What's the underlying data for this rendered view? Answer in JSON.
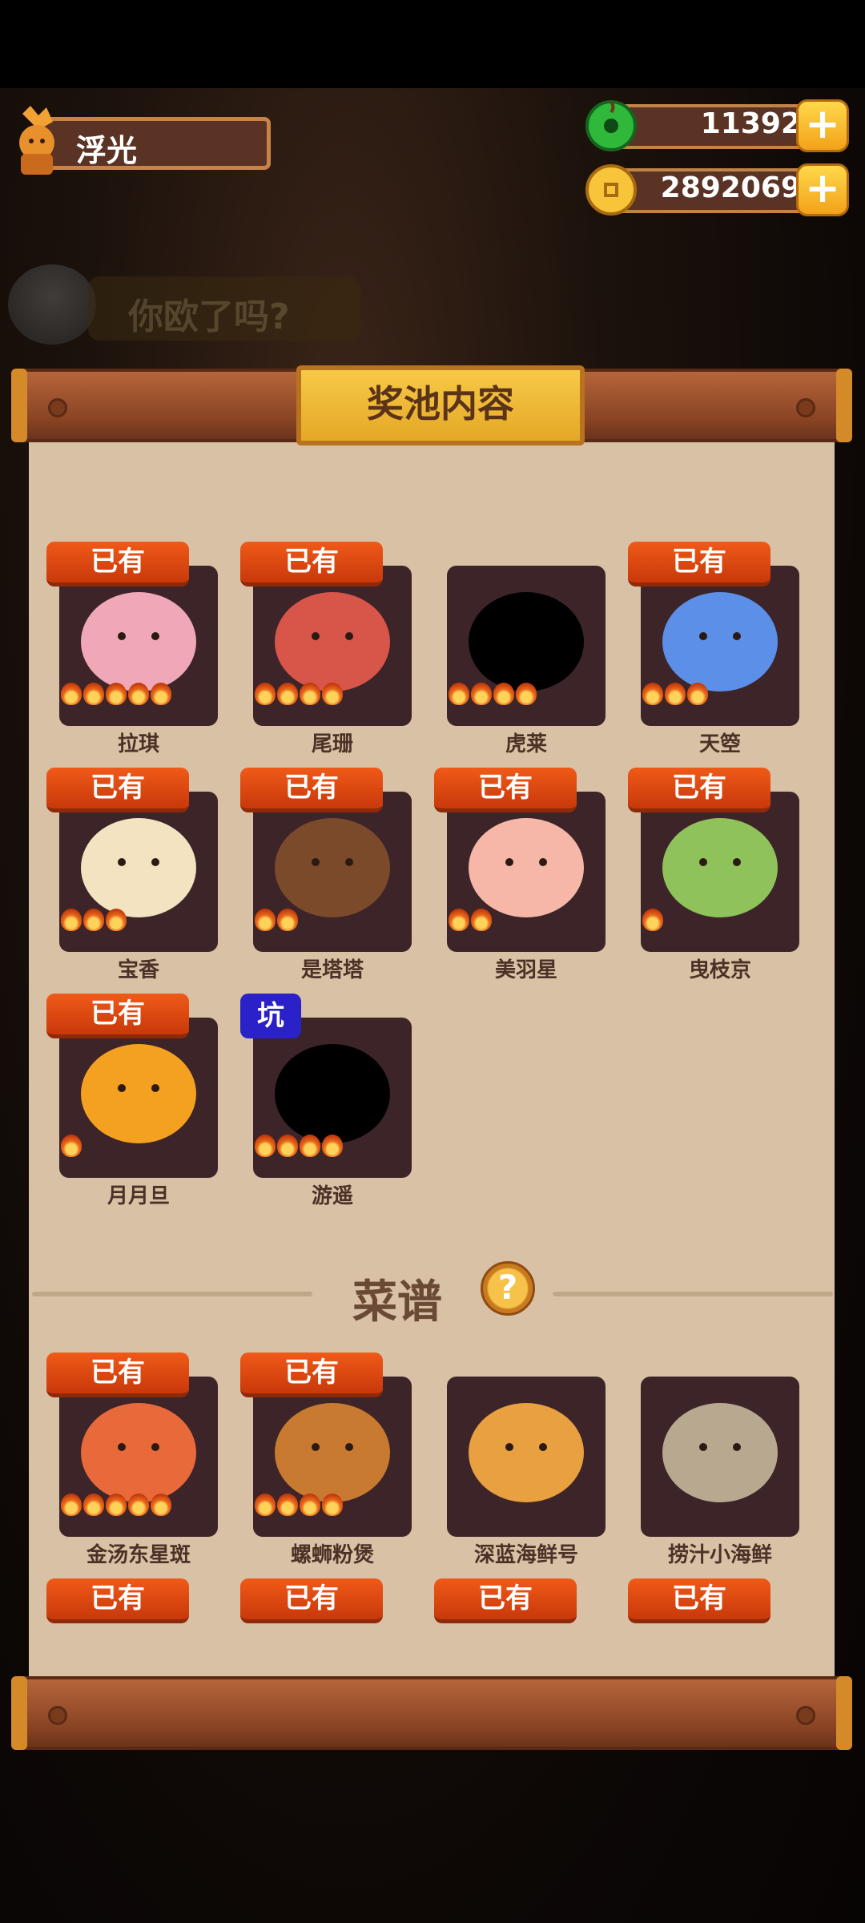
{
  "player": {
    "name": "浮光"
  },
  "currency": {
    "jade": "11392",
    "coins": "2892069"
  },
  "background": {
    "banner_text": "你欧了吗?"
  },
  "panel": {
    "title": "奖池内容"
  },
  "owned_label": "已有",
  "pit_label": "坑",
  "characters": [
    {
      "name": "拉琪",
      "owned": true,
      "stars": 5,
      "color": "#f0a8b8"
    },
    {
      "name": "尾珊",
      "owned": true,
      "stars": 4,
      "color": "#d8554a"
    },
    {
      "name": "虎莱",
      "owned": false,
      "stars": 4,
      "color": "#000000"
    },
    {
      "name": "天箜",
      "owned": true,
      "stars": 3,
      "color": "#5b8fe8"
    },
    {
      "name": "宝香",
      "owned": true,
      "stars": 3,
      "color": "#f3e3c0"
    },
    {
      "name": "是塔塔",
      "owned": true,
      "stars": 2,
      "color": "#7a4a2a"
    },
    {
      "name": "美羽星",
      "owned": true,
      "stars": 2,
      "color": "#f7b7a8"
    },
    {
      "name": "曳枝京",
      "owned": true,
      "stars": 1,
      "color": "#8fc25a"
    },
    {
      "name": "月月旦",
      "owned": true,
      "stars": 1,
      "color": "#f4a020"
    },
    {
      "name": "游遥",
      "owned": false,
      "pit": true,
      "stars": 4,
      "color": "#000000"
    }
  ],
  "recipes_section": {
    "title": "菜谱",
    "help_icon": "?"
  },
  "recipes": [
    {
      "name": "金汤东星斑",
      "owned": true,
      "stars": 5,
      "color": "#e86a3a"
    },
    {
      "name": "螺蛳粉煲",
      "owned": true,
      "stars": 4,
      "color": "#c77a30"
    },
    {
      "name": "深蓝海鲜号",
      "owned": false,
      "stars": 0,
      "color": "#e8a040"
    },
    {
      "name": "捞汁小海鲜",
      "owned": false,
      "stars": 0,
      "color": "#b8a890"
    }
  ],
  "more_owned_labels": [
    "已有",
    "已有",
    "已有",
    "已有"
  ]
}
